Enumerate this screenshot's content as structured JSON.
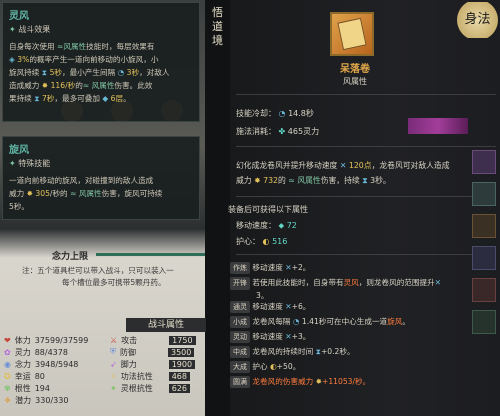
{
  "left_tooltip_1": {
    "title": "灵风",
    "subtitle": "战斗效果",
    "line1_a": "自身每次使用",
    "line1_b": "风属性",
    "line1_c": "技能时，每层效果有",
    "line2_a": "3%",
    "line2_b": "的概率产生一道向前移动的小旋风，小",
    "line3_a": "旋风持续",
    "line3_b": "5秒",
    "line3_c": "，最小产生间隔",
    "line3_d": "3秒",
    "line3_e": "，对敌人",
    "line4_a": "造成威力",
    "line4_b": "116/秒",
    "line4_c": "的",
    "line4_d": "风属性",
    "line4_e": "伤害。此效",
    "line5_a": "果持续",
    "line5_b": "7秒",
    "line5_c": "，最多可叠加",
    "line5_d": "6层",
    "line5_e": "。"
  },
  "left_tooltip_2": {
    "title": "旋风",
    "subtitle": "特殊技能",
    "line1": "一道向前移动的旋风，对碰撞到的敌人造成",
    "line2_a": "威力",
    "line2_b": "305",
    "line2_c": "/秒的",
    "line2_d": "风属性",
    "line2_e": "伤害，旋风可持续",
    "line3": "5秒。"
  },
  "vertical_tab": "悟\n道\n境",
  "character": {
    "mana_limit_label": "念力上限",
    "note_line1": "注：五个道具栏可以带入战斗，只可以装入一",
    "note_line2": "每个槽位最多可携带5颗丹药。",
    "battle_stats_title": "战斗属性",
    "stats": [
      {
        "label": "体力",
        "value": "37599/37599",
        "icon_color": "#c9463d"
      },
      {
        "label": "灵力",
        "value": "88/4378",
        "icon_color": "#b46ad8"
      },
      {
        "label": "念力",
        "value": "3948/5948",
        "icon_color": "#6a8fd8"
      },
      {
        "label": "幸运",
        "value": "80",
        "icon_color": "#e0c050"
      },
      {
        "label": "根性",
        "value": "194",
        "icon_color": "#7fc46a"
      },
      {
        "label": "潜力",
        "value": "330/330",
        "icon_color": "#d8a050"
      }
    ],
    "stats2": [
      {
        "label": "攻击",
        "value": "1750"
      },
      {
        "label": "防御",
        "value": "3500"
      },
      {
        "label": "脚力",
        "value": "1900"
      },
      {
        "label": "功法抗性",
        "value": "468"
      },
      {
        "label": "灵根抗性",
        "value": "626"
      }
    ]
  },
  "item": {
    "name": "呆落卷",
    "type": "风属性",
    "corner_mark": "身法",
    "cooldown_label": "技能冷却：",
    "cooldown_value": "14.8秒",
    "cost_label": "施法消耗：",
    "cost_value": "465灵力",
    "desc_a": "幻化成龙卷风并提升移动速度",
    "desc_b": "120点",
    "desc_c": "，龙卷风可对敌人造成",
    "desc2_a": "威力",
    "desc2_b": "732",
    "desc2_c": "的",
    "desc2_d": "风属性",
    "desc2_e": "伤害，持续",
    "desc2_f": "3秒",
    "desc2_g": "。",
    "equip_label": "装备后可获得以下属性",
    "move_speed_label": "移动速度：",
    "move_speed_value": "72",
    "protect_label": "护心：",
    "protect_value": "516",
    "upgrades": [
      {
        "tag": "作炼",
        "text_a": "移动速度",
        "text_b": "+2。",
        "color": ""
      },
      {
        "tag": "开锋",
        "text_a": "若使用此技能时，自身带有",
        "text_b": "灵风",
        "text_c": "，则龙卷风的范围提升",
        "text_d": "3。"
      },
      {
        "tag": "通灵",
        "text_a": "移动速度",
        "text_b": "+6。"
      },
      {
        "tag": "小成",
        "text_a": "龙卷风每隔",
        "text_b": "1.41秒可在中心生成一道",
        "text_c": "旋风",
        "text_d": "。"
      },
      {
        "tag": "灵动",
        "text_a": "移动速度",
        "text_b": "+3。"
      },
      {
        "tag": "中成",
        "text_a": "龙卷风的持续时间",
        "text_b": "+0.2秒。"
      },
      {
        "tag": "大成",
        "text_a": "护心",
        "text_b": "+50。"
      },
      {
        "tag": "圆满",
        "text_a": "龙卷风的伤害威力",
        "text_b": "+11053/秒。"
      }
    ]
  }
}
